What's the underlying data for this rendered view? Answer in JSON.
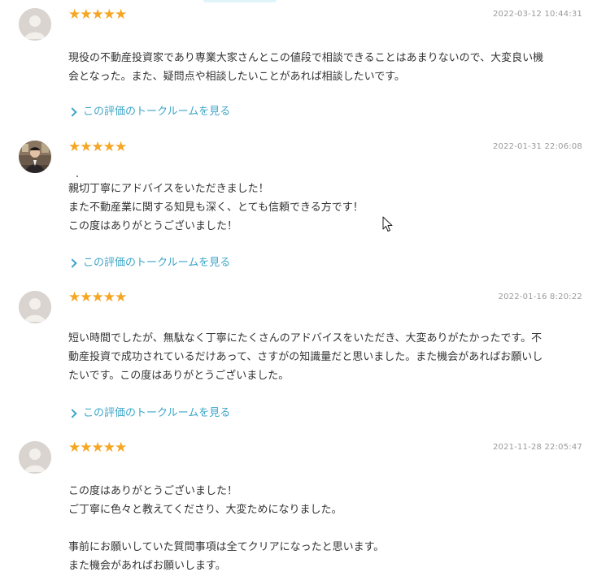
{
  "reviews": [
    {
      "stars": "★★★★★",
      "date": "2022-03-12 10:44:31",
      "avatar": "default-avatar",
      "lines": [
        "現役の不動産投資家であり専業大家さんとこの値段で相談できることはあまりないので、大変良い機",
        "会となった。また、疑問点や相談したいことがあれば相談したいです。"
      ],
      "link": "この評価のトークルームを見る"
    },
    {
      "stars": "★★★★★",
      "date": "2022-01-31 22:06:08",
      "avatar": "photo-avatar",
      "lines": [
        "親切丁寧にアドバイスをいただきました！",
        "また不動産業に関する知見も深く、とても信頼できる方です！",
        "この度はありがとうございました！"
      ],
      "link": "この評価のトークルームを見る"
    },
    {
      "stars": "★★★★★",
      "date": "2022-01-16 8:20:22",
      "avatar": "default-avatar",
      "lines": [
        "短い時間でしたが、無駄なく丁寧にたくさんのアドバイスをいただき、大変ありがたかったです。不",
        "動産投資で成功されているだけあって、さすがの知識量だと思いました。また機会があればお願いし",
        "たいです。この度はありがとうございました。"
      ],
      "link": "この評価のトークルームを見る"
    },
    {
      "stars": "★★★★★",
      "date": "2021-11-28 22:05:47",
      "avatar": "default-avatar",
      "lines": [
        "この度はありがとうございました！",
        "ご丁寧に色々と教えてくださり、大変ためになりました。",
        "",
        "事前にお願いしていた質問事項は全てクリアになったと思います。",
        "また機会があればお願いします。"
      ]
    }
  ],
  "colors": {
    "star": "#f5a623",
    "link": "#3ea6c9",
    "date": "#9a9a9a",
    "text": "#333333",
    "avatar_bg": "#d9d4cf"
  },
  "icons": {
    "rating": "star-icon",
    "link": "chevron-right-icon",
    "avatar": "user-avatar-icon",
    "cursor": "mouse-pointer-icon"
  }
}
